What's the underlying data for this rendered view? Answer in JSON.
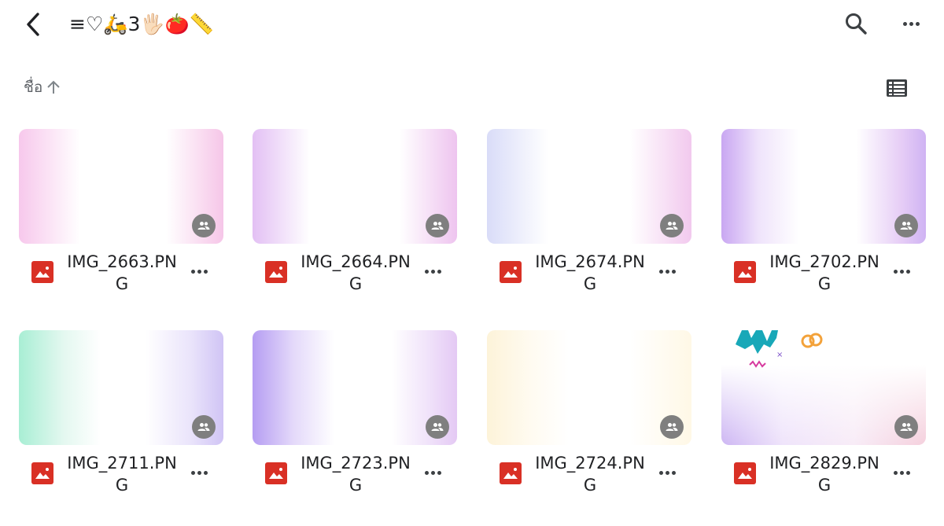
{
  "header": {
    "title": "≡♡🛵3🖐🏻🍅📏",
    "back_icon": "chevron-left-icon",
    "search_icon": "search-icon",
    "more_icon": "more-horizontal-icon"
  },
  "sort": {
    "label": "ชื่อ",
    "direction_icon": "arrow-up-icon",
    "view_icon": "list-view-icon"
  },
  "colors": {
    "file_icon_red": "#d93025",
    "shared_badge": "#7f7f7f",
    "text": "#202124"
  },
  "files": [
    {
      "name": "IMG_2663.PNG",
      "type_icon": "image-file-icon",
      "shared_icon": "people-icon"
    },
    {
      "name": "IMG_2664.PNG",
      "type_icon": "image-file-icon",
      "shared_icon": "people-icon"
    },
    {
      "name": "IMG_2674.PNG",
      "type_icon": "image-file-icon",
      "shared_icon": "people-icon"
    },
    {
      "name": "IMG_2702.PNG",
      "type_icon": "image-file-icon",
      "shared_icon": "people-icon"
    },
    {
      "name": "IMG_2711.PNG",
      "type_icon": "image-file-icon",
      "shared_icon": "people-icon"
    },
    {
      "name": "IMG_2723.PNG",
      "type_icon": "image-file-icon",
      "shared_icon": "people-icon"
    },
    {
      "name": "IMG_2724.PNG",
      "type_icon": "image-file-icon",
      "shared_icon": "people-icon"
    },
    {
      "name": "IMG_2829.PNG",
      "type_icon": "image-file-icon",
      "shared_icon": "people-icon"
    }
  ]
}
